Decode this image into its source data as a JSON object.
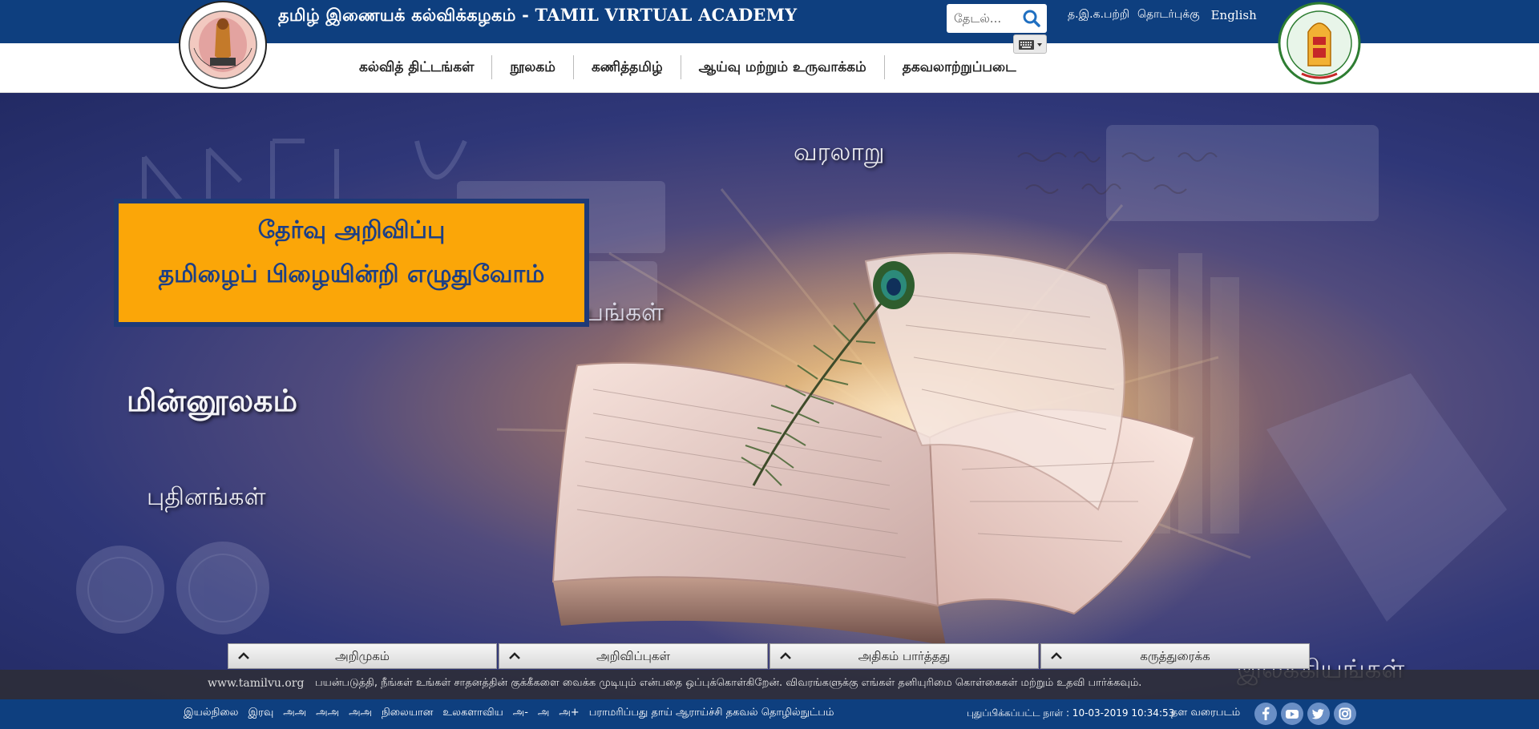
{
  "header": {
    "site_title": "தமிழ் இணையக் கல்விக்கழகம் - TAMIL VIRTUAL ACADEMY",
    "search_placeholder": "தேடல்...",
    "top_links": [
      "த.இ.க.பற்றி",
      "தொடர்புக்கு",
      "English"
    ]
  },
  "nav": {
    "items": [
      "கல்வித் திட்டங்கள்",
      "நூலகம்",
      "கணித்தமிழ்",
      "ஆய்வு மற்றும் உருவாக்கம்",
      "தகவலாற்றுப்படை"
    ]
  },
  "hero": {
    "labels": {
      "varalaru": "வரலாறு",
      "minnulagam": "மின்னூலகம்",
      "pudhinangal": "புதினங்கள்",
      "angal": "பங்கள்",
      "ilakkiyangal": "இலக்கியங்கள்"
    },
    "notice": {
      "line1": "தேர்வு அறிவிப்பு",
      "line2": "தமிழைப் பிழையின்றி எழுதுவோம்"
    }
  },
  "bottom_tabs": [
    "அறிமுகம்",
    "அறிவிப்புகள்",
    "அதிகம் பார்த்தது",
    "கருத்துரைக்க"
  ],
  "cookie": {
    "site": "www.tamilvu.org",
    "text": "பயன்படுத்தி, நீங்கள் உங்கள் சாதனத்தின் குக்கீகளை வைக்க முடியும் என்பதை ஒப்புக்கொள்கிறேன். விவரங்களுக்கு எங்கள் தனியுரிமை கொள்கைகள் மற்றும் உதவி பார்க்கவும்."
  },
  "footer": {
    "links": [
      "இயல்நிலை",
      "இரவு",
      "அஅ",
      "அஅ",
      "அஅ",
      "நிலையான",
      "உலகளாவிய",
      "அ-",
      "அ",
      "அ+",
      "பராமரிப்பது தாய் ஆராய்ச்சி தகவல் தொழில்நுட்பம்"
    ],
    "updated": "புதுப்பிக்கப்பட்ட நாள் : 10-03-2019 10:34:53",
    "sitemap": "தள வரைபடம்",
    "socials": [
      "facebook-icon",
      "youtube-icon",
      "twitter-icon",
      "instagram-icon"
    ]
  },
  "colors": {
    "header_bg": "#0e3f7f",
    "notice_bg": "#fba608",
    "notice_text": "#1c3f86"
  }
}
